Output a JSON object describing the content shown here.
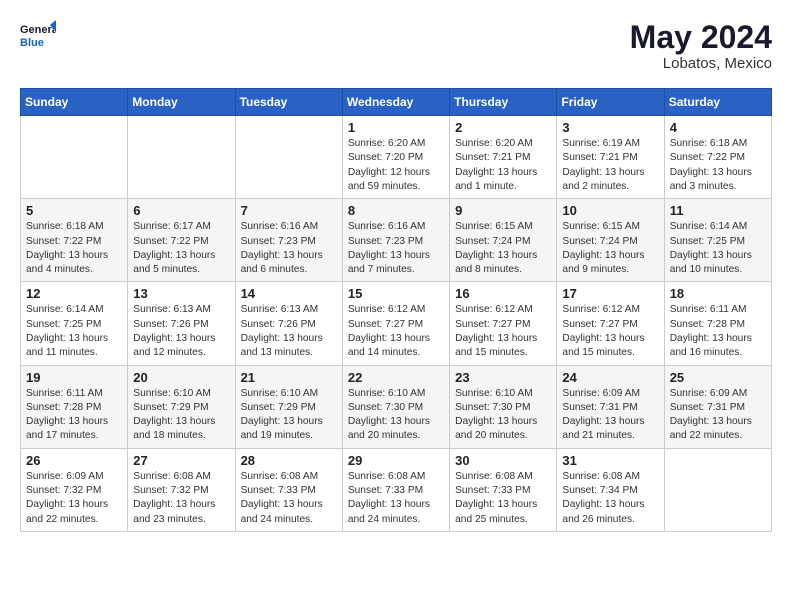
{
  "header": {
    "logo_general": "General",
    "logo_blue": "Blue",
    "month_year": "May 2024",
    "location": "Lobatos, Mexico"
  },
  "days_of_week": [
    "Sunday",
    "Monday",
    "Tuesday",
    "Wednesday",
    "Thursday",
    "Friday",
    "Saturday"
  ],
  "weeks": [
    [
      {
        "day": "",
        "sunrise": "",
        "sunset": "",
        "daylight": ""
      },
      {
        "day": "",
        "sunrise": "",
        "sunset": "",
        "daylight": ""
      },
      {
        "day": "",
        "sunrise": "",
        "sunset": "",
        "daylight": ""
      },
      {
        "day": "1",
        "sunrise": "Sunrise: 6:20 AM",
        "sunset": "Sunset: 7:20 PM",
        "daylight": "Daylight: 12 hours and 59 minutes."
      },
      {
        "day": "2",
        "sunrise": "Sunrise: 6:20 AM",
        "sunset": "Sunset: 7:21 PM",
        "daylight": "Daylight: 13 hours and 1 minute."
      },
      {
        "day": "3",
        "sunrise": "Sunrise: 6:19 AM",
        "sunset": "Sunset: 7:21 PM",
        "daylight": "Daylight: 13 hours and 2 minutes."
      },
      {
        "day": "4",
        "sunrise": "Sunrise: 6:18 AM",
        "sunset": "Sunset: 7:22 PM",
        "daylight": "Daylight: 13 hours and 3 minutes."
      }
    ],
    [
      {
        "day": "5",
        "sunrise": "Sunrise: 6:18 AM",
        "sunset": "Sunset: 7:22 PM",
        "daylight": "Daylight: 13 hours and 4 minutes."
      },
      {
        "day": "6",
        "sunrise": "Sunrise: 6:17 AM",
        "sunset": "Sunset: 7:22 PM",
        "daylight": "Daylight: 13 hours and 5 minutes."
      },
      {
        "day": "7",
        "sunrise": "Sunrise: 6:16 AM",
        "sunset": "Sunset: 7:23 PM",
        "daylight": "Daylight: 13 hours and 6 minutes."
      },
      {
        "day": "8",
        "sunrise": "Sunrise: 6:16 AM",
        "sunset": "Sunset: 7:23 PM",
        "daylight": "Daylight: 13 hours and 7 minutes."
      },
      {
        "day": "9",
        "sunrise": "Sunrise: 6:15 AM",
        "sunset": "Sunset: 7:24 PM",
        "daylight": "Daylight: 13 hours and 8 minutes."
      },
      {
        "day": "10",
        "sunrise": "Sunrise: 6:15 AM",
        "sunset": "Sunset: 7:24 PM",
        "daylight": "Daylight: 13 hours and 9 minutes."
      },
      {
        "day": "11",
        "sunrise": "Sunrise: 6:14 AM",
        "sunset": "Sunset: 7:25 PM",
        "daylight": "Daylight: 13 hours and 10 minutes."
      }
    ],
    [
      {
        "day": "12",
        "sunrise": "Sunrise: 6:14 AM",
        "sunset": "Sunset: 7:25 PM",
        "daylight": "Daylight: 13 hours and 11 minutes."
      },
      {
        "day": "13",
        "sunrise": "Sunrise: 6:13 AM",
        "sunset": "Sunset: 7:26 PM",
        "daylight": "Daylight: 13 hours and 12 minutes."
      },
      {
        "day": "14",
        "sunrise": "Sunrise: 6:13 AM",
        "sunset": "Sunset: 7:26 PM",
        "daylight": "Daylight: 13 hours and 13 minutes."
      },
      {
        "day": "15",
        "sunrise": "Sunrise: 6:12 AM",
        "sunset": "Sunset: 7:27 PM",
        "daylight": "Daylight: 13 hours and 14 minutes."
      },
      {
        "day": "16",
        "sunrise": "Sunrise: 6:12 AM",
        "sunset": "Sunset: 7:27 PM",
        "daylight": "Daylight: 13 hours and 15 minutes."
      },
      {
        "day": "17",
        "sunrise": "Sunrise: 6:12 AM",
        "sunset": "Sunset: 7:27 PM",
        "daylight": "Daylight: 13 hours and 15 minutes."
      },
      {
        "day": "18",
        "sunrise": "Sunrise: 6:11 AM",
        "sunset": "Sunset: 7:28 PM",
        "daylight": "Daylight: 13 hours and 16 minutes."
      }
    ],
    [
      {
        "day": "19",
        "sunrise": "Sunrise: 6:11 AM",
        "sunset": "Sunset: 7:28 PM",
        "daylight": "Daylight: 13 hours and 17 minutes."
      },
      {
        "day": "20",
        "sunrise": "Sunrise: 6:10 AM",
        "sunset": "Sunset: 7:29 PM",
        "daylight": "Daylight: 13 hours and 18 minutes."
      },
      {
        "day": "21",
        "sunrise": "Sunrise: 6:10 AM",
        "sunset": "Sunset: 7:29 PM",
        "daylight": "Daylight: 13 hours and 19 minutes."
      },
      {
        "day": "22",
        "sunrise": "Sunrise: 6:10 AM",
        "sunset": "Sunset: 7:30 PM",
        "daylight": "Daylight: 13 hours and 20 minutes."
      },
      {
        "day": "23",
        "sunrise": "Sunrise: 6:10 AM",
        "sunset": "Sunset: 7:30 PM",
        "daylight": "Daylight: 13 hours and 20 minutes."
      },
      {
        "day": "24",
        "sunrise": "Sunrise: 6:09 AM",
        "sunset": "Sunset: 7:31 PM",
        "daylight": "Daylight: 13 hours and 21 minutes."
      },
      {
        "day": "25",
        "sunrise": "Sunrise: 6:09 AM",
        "sunset": "Sunset: 7:31 PM",
        "daylight": "Daylight: 13 hours and 22 minutes."
      }
    ],
    [
      {
        "day": "26",
        "sunrise": "Sunrise: 6:09 AM",
        "sunset": "Sunset: 7:32 PM",
        "daylight": "Daylight: 13 hours and 22 minutes."
      },
      {
        "day": "27",
        "sunrise": "Sunrise: 6:08 AM",
        "sunset": "Sunset: 7:32 PM",
        "daylight": "Daylight: 13 hours and 23 minutes."
      },
      {
        "day": "28",
        "sunrise": "Sunrise: 6:08 AM",
        "sunset": "Sunset: 7:33 PM",
        "daylight": "Daylight: 13 hours and 24 minutes."
      },
      {
        "day": "29",
        "sunrise": "Sunrise: 6:08 AM",
        "sunset": "Sunset: 7:33 PM",
        "daylight": "Daylight: 13 hours and 24 minutes."
      },
      {
        "day": "30",
        "sunrise": "Sunrise: 6:08 AM",
        "sunset": "Sunset: 7:33 PM",
        "daylight": "Daylight: 13 hours and 25 minutes."
      },
      {
        "day": "31",
        "sunrise": "Sunrise: 6:08 AM",
        "sunset": "Sunset: 7:34 PM",
        "daylight": "Daylight: 13 hours and 26 minutes."
      },
      {
        "day": "",
        "sunrise": "",
        "sunset": "",
        "daylight": ""
      }
    ]
  ]
}
